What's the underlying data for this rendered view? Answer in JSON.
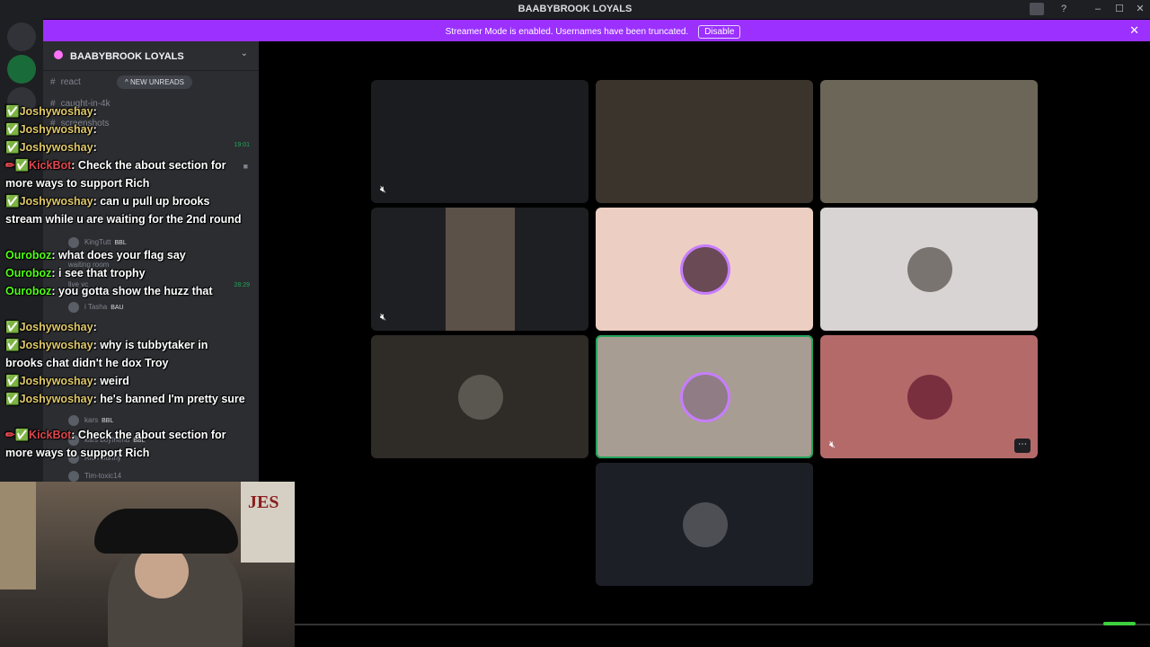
{
  "window": {
    "title": "BAABYBROOK LOYALS"
  },
  "banner": {
    "message": "Streamer Mode is enabled. Usernames have been truncated.",
    "disable_label": "Disable"
  },
  "sidebar": {
    "server_name": "BAABYBROOK LOYALS",
    "channels": [
      {
        "name": "react"
      },
      {
        "name": "caught-in-4k"
      },
      {
        "name": "screenshots"
      }
    ],
    "new_unreads_label": "NEW UNREADS",
    "voice_users": [
      {
        "name": "KingTutt",
        "badge": "BBL"
      },
      {
        "name": "waiting room"
      },
      {
        "name": "live vc"
      },
      {
        "name": "i Tasha",
        "badge": "BAU"
      },
      {
        "name": "kars",
        "badge": "BBL"
      },
      {
        "name": "kars boyfriend",
        "badge": "BBL"
      },
      {
        "name": "Rich Bunny"
      },
      {
        "name": "Tim-toxic14"
      }
    ],
    "timestamps": [
      "19:01",
      "28:29"
    ]
  },
  "chat": [
    {
      "badges": "✅",
      "user": "Joshywoshay",
      "text": ""
    },
    {
      "badges": "✅",
      "user": "Joshywoshay",
      "text": ""
    },
    {
      "badges": "✅",
      "user": "Joshywoshay",
      "text": ""
    },
    {
      "badges": "✏✅",
      "user": "KickBot",
      "text": "Check the about section for more ways to support Rich"
    },
    {
      "badges": "✅",
      "user": "Joshywoshay",
      "text": "can u pull up brooks stream while u are waiting for the 2nd round"
    },
    {
      "badges": "",
      "user": "Ouroboz",
      "text": "what does your flag say"
    },
    {
      "badges": "",
      "user": "Ouroboz",
      "text": "i see that trophy"
    },
    {
      "badges": "",
      "user": "Ouroboz",
      "text": "you gotta show the huzz that"
    },
    {
      "badges": "✅",
      "user": "Joshywoshay",
      "text": ""
    },
    {
      "badges": "✅",
      "user": "Joshywoshay",
      "text": "why is tubbytaker in brooks chat didn't he dox Troy"
    },
    {
      "badges": "✅",
      "user": "Joshywoshay",
      "text": "weird"
    },
    {
      "badges": "✅",
      "user": "Joshywoshay",
      "text": "he's banned I'm pretty sure"
    },
    {
      "badges": "✏✅",
      "user": "KickBot",
      "text": "Check the about section for more ways to support Rich"
    }
  ],
  "webcam": {
    "poster_text": "JES"
  },
  "tiles": [
    {
      "kind": "screen",
      "bg": "#1b1c1f",
      "muted": true
    },
    {
      "kind": "camera",
      "bg": "#3b342c",
      "muted": false
    },
    {
      "kind": "camera",
      "bg": "#6b6657",
      "muted": false
    },
    {
      "kind": "camera",
      "bg": "#1e1f22",
      "muted": true
    },
    {
      "kind": "avatar",
      "bg": "#eccfc2",
      "muted": false
    },
    {
      "kind": "avatar",
      "bg": "#d8d4d3",
      "muted": false
    },
    {
      "kind": "avatar",
      "bg": "#2f2b27",
      "muted": false
    },
    {
      "kind": "avatar",
      "bg": "#a89d93",
      "muted": false,
      "speaking": true
    },
    {
      "kind": "avatar",
      "bg": "#b56a6a",
      "muted": true,
      "more": true
    },
    {
      "kind": "avatar",
      "bg": "#1d1f26",
      "muted": false
    }
  ],
  "colors": {
    "accent": "#9b30ff",
    "speaking": "#23a55a",
    "username_green": "#53fc18",
    "kickbot_red": "#e0464e"
  }
}
